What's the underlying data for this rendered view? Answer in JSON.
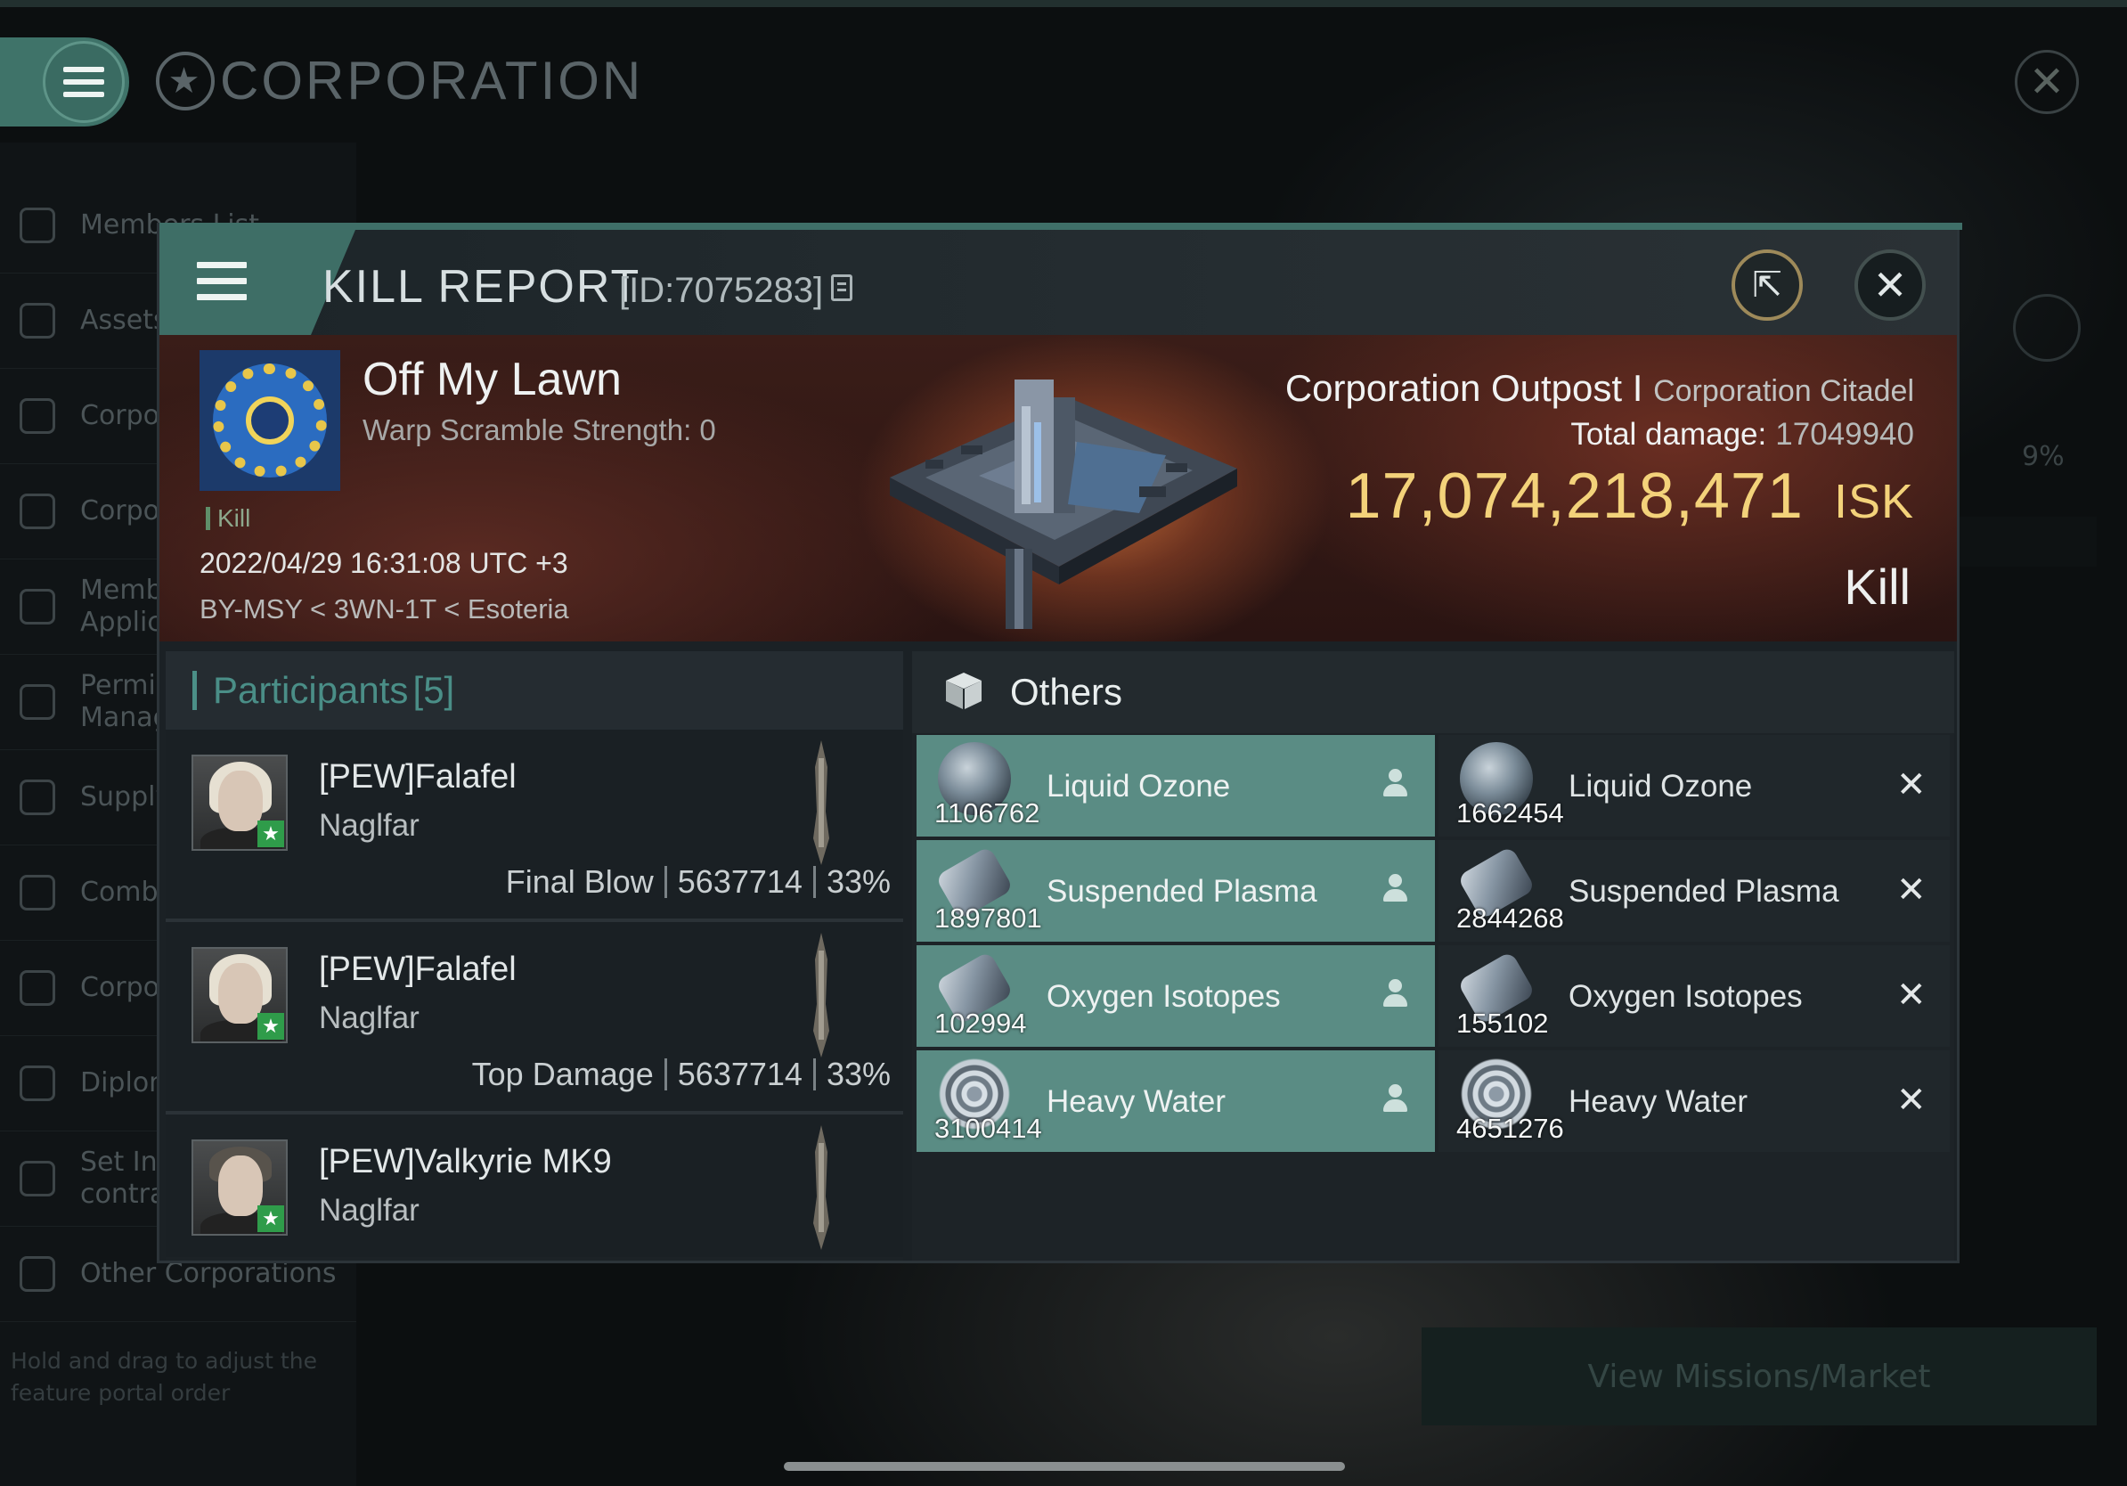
{
  "background": {
    "title": "CORPORATION",
    "nav_items": [
      {
        "label": "Members List"
      },
      {
        "label": "Assets"
      },
      {
        "label": "Corpor"
      },
      {
        "label": "Corpor"
      },
      {
        "label": "Membe\nApplic"
      },
      {
        "label": "Permis\nManag"
      },
      {
        "label": "Supply"
      },
      {
        "label": "Comba"
      },
      {
        "label": "Corpor"
      },
      {
        "label": "Diplom"
      },
      {
        "label": "Set Ins\ncontra"
      },
      {
        "label": "Other Corporations"
      }
    ],
    "hint": "Hold and drag to adjust the feature portal order",
    "percent": "9%",
    "missions_button": "View Missions/Market"
  },
  "header": {
    "title": "KILL REPORT",
    "id": "[ID:7075283]"
  },
  "victim": {
    "name": "Off My Lawn",
    "warp_scramble": "Warp Scramble Strength: 0",
    "kill_tag": "Kill",
    "timestamp": "2022/04/29 16:31:08 UTC +3",
    "location": "BY-MSY < 3WN-1T < Esoteria"
  },
  "target": {
    "name": "Corporation Outpost I",
    "type": "Corporation Citadel",
    "total_damage_label": "Total damage:",
    "total_damage": "17049940",
    "isk_value": "17,074,218,471",
    "isk_unit": "ISK",
    "result": "Kill"
  },
  "participants": {
    "title": "Participants",
    "count": "[5]",
    "rows": [
      {
        "name": "[PEW]Falafel",
        "ship": "Naglfar",
        "role": "Final Blow",
        "damage": "5637714",
        "percent": "33%"
      },
      {
        "name": "[PEW]Falafel",
        "ship": "Naglfar",
        "role": "Top Damage",
        "damage": "5637714",
        "percent": "33%"
      },
      {
        "name": "[PEW]Valkyrie MK9",
        "ship": "Naglfar"
      }
    ]
  },
  "others": {
    "title": "Others",
    "items": [
      {
        "name": "Liquid Ozone",
        "qty": "1106762",
        "status": "dropped",
        "icon": "ozone"
      },
      {
        "name": "Liquid Ozone",
        "qty": "1662454",
        "status": "destroyed",
        "icon": "ozone"
      },
      {
        "name": "Suspended Plasma",
        "qty": "1897801",
        "status": "dropped",
        "icon": "canister"
      },
      {
        "name": "Suspended Plasma",
        "qty": "2844268",
        "status": "destroyed",
        "icon": "canister"
      },
      {
        "name": "Oxygen Isotopes",
        "qty": "102994",
        "status": "dropped",
        "icon": "canister"
      },
      {
        "name": "Oxygen Isotopes",
        "qty": "155102",
        "status": "destroyed",
        "icon": "canister"
      },
      {
        "name": "Heavy Water",
        "qty": "3100414",
        "status": "dropped",
        "icon": "coil"
      },
      {
        "name": "Heavy Water",
        "qty": "4651276",
        "status": "destroyed",
        "icon": "coil"
      }
    ]
  },
  "colors": {
    "accent": "#3e6e66",
    "isk": "#f3d27a",
    "participants_title": "#4a8e87",
    "dropped_row": "#5a8c84"
  }
}
